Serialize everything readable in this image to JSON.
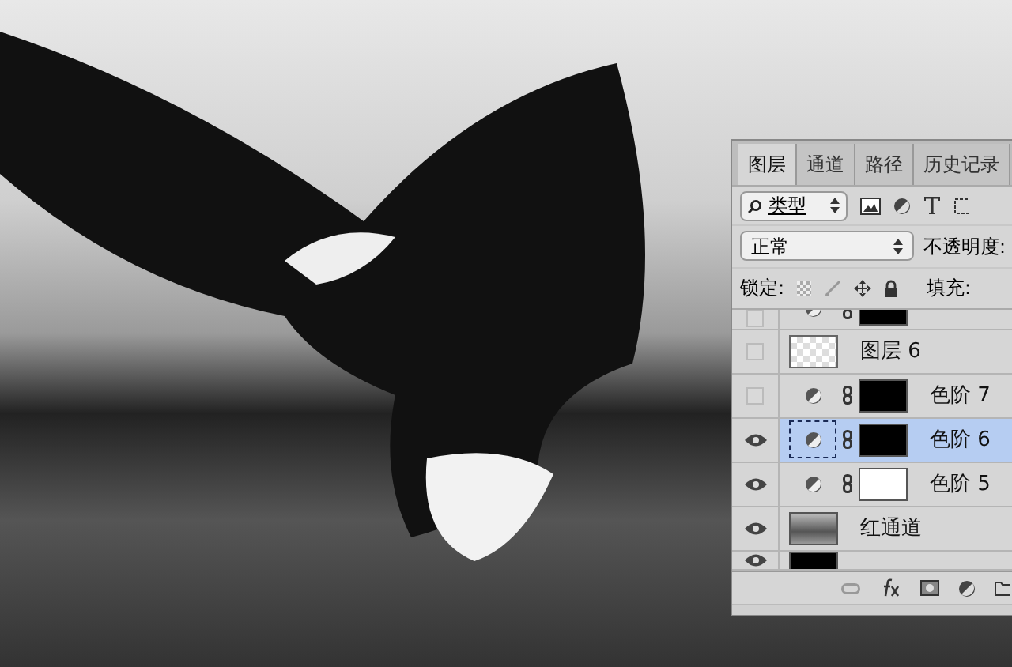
{
  "panel": {
    "tabs": [
      {
        "label": "图层",
        "selected": true
      },
      {
        "label": "通道",
        "selected": false
      },
      {
        "label": "路径",
        "selected": false
      },
      {
        "label": "历史记录",
        "selected": false
      }
    ],
    "filter": {
      "value": "类型"
    },
    "blend": {
      "value": "正常",
      "opacity_label": "不透明度:"
    },
    "lock": {
      "label": "锁定:",
      "fill_label": "填充:"
    },
    "layers": [
      {
        "kind": "black",
        "visible": false,
        "selected": false,
        "adjustment": true
      },
      {
        "kind": "checker",
        "name": "图层 6",
        "visible": false,
        "selected": false,
        "adjustment": false
      },
      {
        "kind": "black",
        "name": "色阶 7",
        "visible": false,
        "selected": false,
        "adjustment": true
      },
      {
        "kind": "black",
        "name": "色阶 6",
        "visible": true,
        "selected": true,
        "adjustment": true
      },
      {
        "kind": "white",
        "name": "色阶 5",
        "visible": true,
        "selected": false,
        "adjustment": true
      },
      {
        "kind": "photo",
        "name": "红通道",
        "visible": true,
        "selected": false,
        "adjustment": false
      },
      {
        "kind": "black",
        "visible": true,
        "selected": false,
        "adjustment": false
      }
    ]
  }
}
